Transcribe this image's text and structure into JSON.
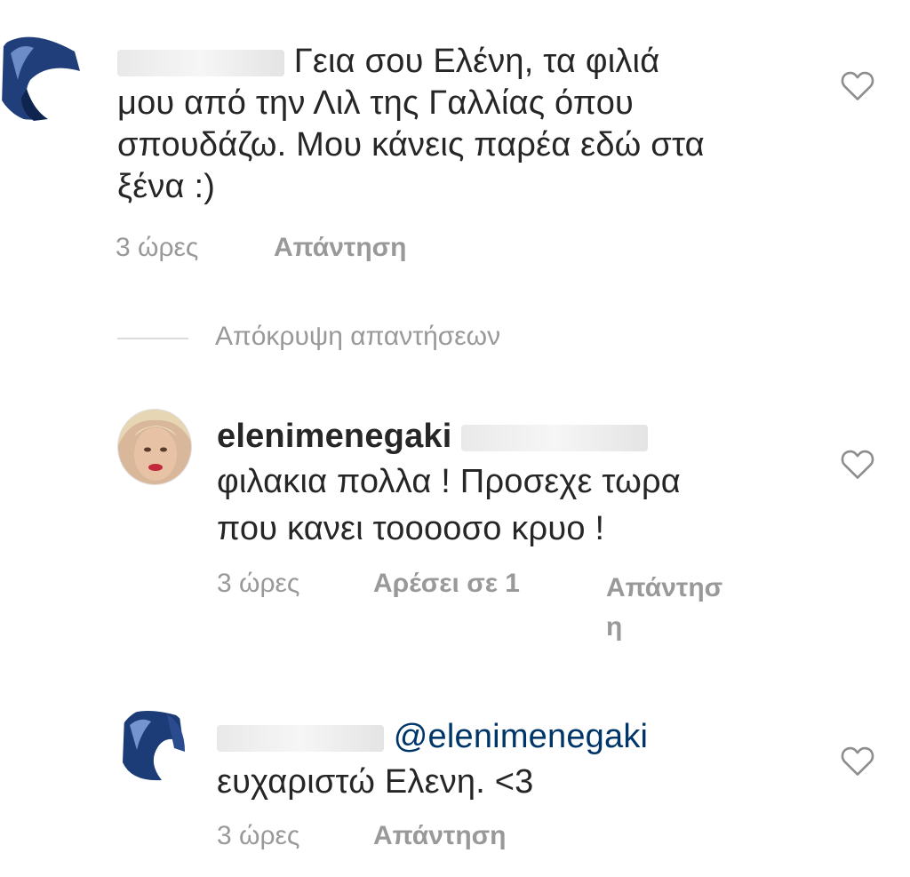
{
  "comments": [
    {
      "text": "Γεια σου Ελένη, τα φιλιά μου από την Λιλ της Γαλλίας όπου σπουδάζω. Μου κάνεις παρέα εδώ στα ξένα :)",
      "lines": [
        "Γεια σου Ελένη, τα φιλιά",
        "μου από την Λιλ της Γαλλίας όπου",
        "σπουδάζω. Μου κάνεις παρέα εδώ στα",
        "ξένα :)"
      ],
      "time": "3 ώρες",
      "reply": "Απάντηση"
    }
  ],
  "hide_replies": "Απόκρυψη απαντήσεων",
  "replies": [
    {
      "username": "elenimenegaki",
      "lines": [
        "φιλακια πολλα ! Προσεχε τωρα",
        "που κανει τοοοοσο κρυο !"
      ],
      "time": "3 ώρες",
      "likes": "Αρέσει σε 1",
      "reply_line1": "Απάντησ",
      "reply_line2": "η"
    },
    {
      "mention": "@elenimenegaki",
      "text": "ευχαριστώ Ελενη. <3",
      "time": "3 ώρες",
      "reply": "Απάντηση"
    }
  ],
  "colors": {
    "text": "#262626",
    "meta": "#999999",
    "mention": "#003569"
  },
  "icons": {
    "like": "heart-outline-icon"
  }
}
